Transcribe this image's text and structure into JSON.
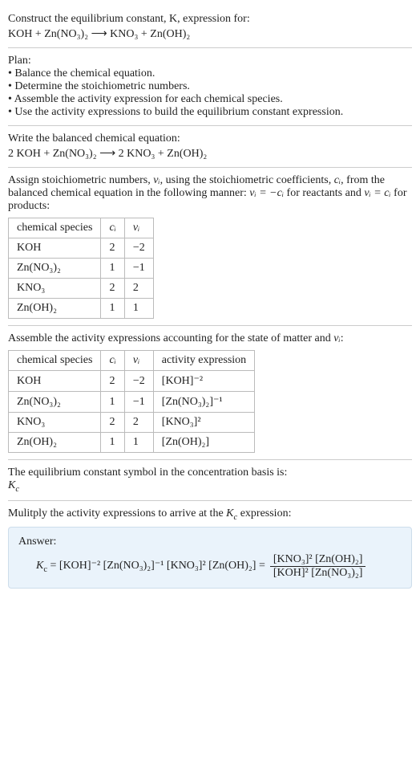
{
  "intro": {
    "prompt": "Construct the equilibrium constant, K, expression for:",
    "eq_unbalanced": "KOH + Zn(NO₃)₂  ⟶  KNO₃ + Zn(OH)₂"
  },
  "plan": {
    "heading": "Plan:",
    "items": [
      "• Balance the chemical equation.",
      "• Determine the stoichiometric numbers.",
      "• Assemble the activity expression for each chemical species.",
      "• Use the activity expressions to build the equilibrium constant expression."
    ]
  },
  "balanced": {
    "heading": "Write the balanced chemical equation:",
    "eq": "2 KOH + Zn(NO₃)₂  ⟶  2 KNO₃ + Zn(OH)₂"
  },
  "stoich": {
    "heading_a": "Assign stoichiometric numbers, ",
    "heading_b": ", using the stoichiometric coefficients, ",
    "heading_c": ", from the balanced chemical equation in the following manner: ",
    "heading_d": " for reactants and ",
    "heading_e": " for products:",
    "nu_i": "νᵢ",
    "c_i": "cᵢ",
    "rel_react": "νᵢ = −cᵢ",
    "rel_prod": "νᵢ = cᵢ",
    "headers": {
      "species": "chemical species",
      "ci": "cᵢ",
      "vi": "νᵢ"
    },
    "rows": [
      {
        "species": "KOH",
        "ci": "2",
        "vi": "−2"
      },
      {
        "species": "Zn(NO₃)₂",
        "ci": "1",
        "vi": "−1"
      },
      {
        "species": "KNO₃",
        "ci": "2",
        "vi": "2"
      },
      {
        "species": "Zn(OH)₂",
        "ci": "1",
        "vi": "1"
      }
    ]
  },
  "activity": {
    "heading_a": "Assemble the activity expressions accounting for the state of matter and ",
    "heading_b": ":",
    "nu_i": "νᵢ",
    "headers": {
      "species": "chemical species",
      "ci": "cᵢ",
      "vi": "νᵢ",
      "act": "activity expression"
    },
    "rows": [
      {
        "species": "KOH",
        "ci": "2",
        "vi": "−2",
        "act": "[KOH]⁻²"
      },
      {
        "species": "Zn(NO₃)₂",
        "ci": "1",
        "vi": "−1",
        "act": "[Zn(NO₃)₂]⁻¹"
      },
      {
        "species": "KNO₃",
        "ci": "2",
        "vi": "2",
        "act": "[KNO₃]²"
      },
      {
        "species": "Zn(OH)₂",
        "ci": "1",
        "vi": "1",
        "act": "[Zn(OH)₂]"
      }
    ]
  },
  "kc_basis": {
    "heading": "The equilibrium constant symbol in the concentration basis is:",
    "symbol_html": "K_c"
  },
  "multiply": {
    "heading_a": "Mulitply the activity expressions to arrive at the ",
    "heading_b": " expression:",
    "kc": "K_c"
  },
  "answer": {
    "label": "Answer:",
    "lhs": "K_c = [KOH]⁻² [Zn(NO₃)₂]⁻¹ [KNO₃]² [Zn(OH)₂] =",
    "num": "[KNO₃]² [Zn(OH)₂]",
    "den": "[KOH]² [Zn(NO₃)₂]"
  }
}
